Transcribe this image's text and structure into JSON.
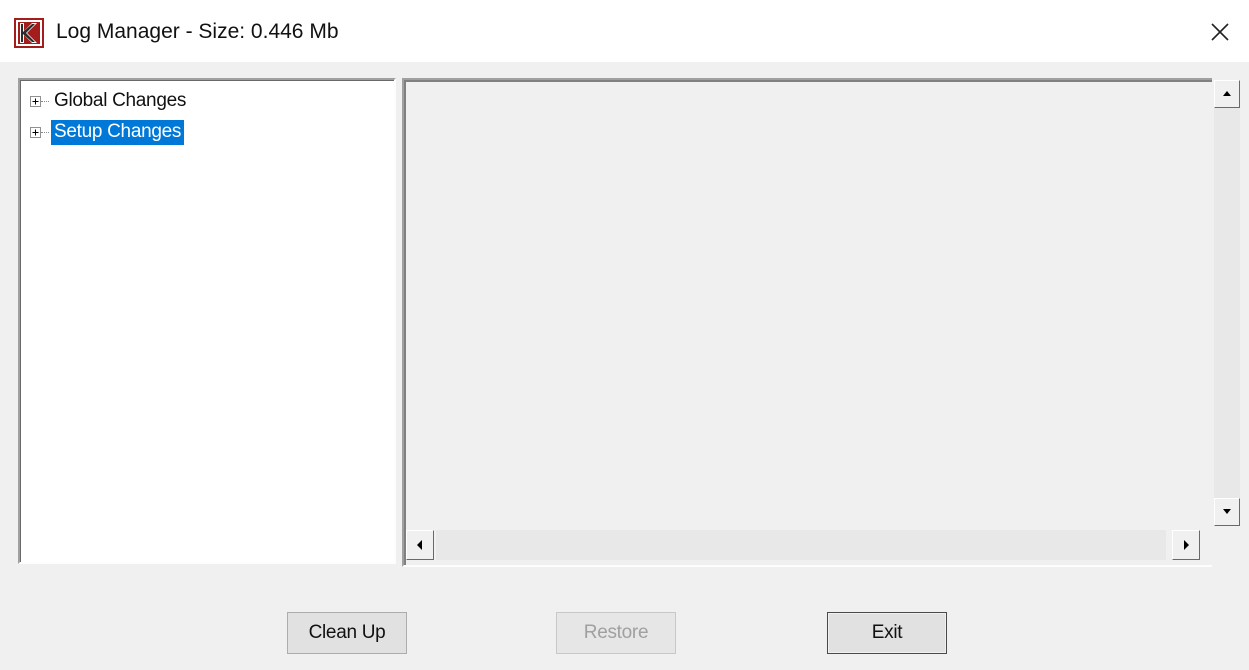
{
  "window": {
    "title": "Log Manager - Size: 0.446 Mb",
    "app_icon": "k-logo-icon",
    "close_icon": "close-icon",
    "brand_color": "#a31d1d"
  },
  "tree": {
    "items": [
      {
        "label": "Global Changes",
        "expanded": false,
        "selected": false
      },
      {
        "label": "Setup Changes",
        "expanded": false,
        "selected": true
      }
    ],
    "selection_color": "#0078d7"
  },
  "buttons": {
    "clean_up": "Clean Up",
    "restore": "Restore",
    "exit": "Exit"
  }
}
